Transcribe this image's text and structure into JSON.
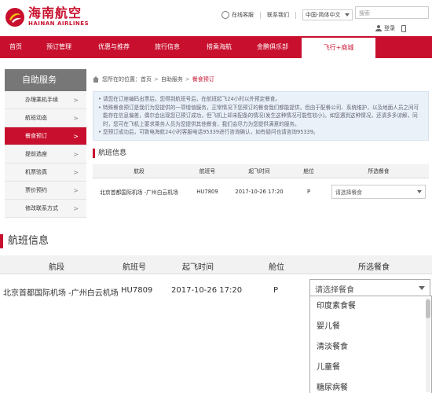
{
  "logo": {
    "cn": "海南航空",
    "en": "HAINAN AIRLINES"
  },
  "top_links": {
    "service": "在线客服",
    "contact": "联系我们",
    "language": "中国-简体中文",
    "search_placeholder": "搜索",
    "login": "登录",
    "phone_icon": "mobile-icon"
  },
  "nav": [
    "首页",
    "预订管理",
    "优惠与推荐",
    "旅行信息",
    "搭乘海航",
    "金鹏俱乐部",
    "飞行+商城"
  ],
  "sidebar": {
    "title": "自助服务",
    "items": [
      "办理乘机手续",
      "航班动态",
      "餐食预订",
      "提前选座",
      "机票验真",
      "票价预约",
      "修改联系方式"
    ],
    "active": "餐食预订"
  },
  "breadcrumb": {
    "prefix": "您所在的位置：",
    "home": "首页",
    "level2": "自助服务",
    "current": "餐食预订"
  },
  "notice": [
    "请您在订座编码出票后，您得到航班号后，在航班起飞24小时以外预定餐食。",
    "特殊餐食预订是我们为您提供的一项增值服务，正常情况下您预订的餐食我们都能提供，但由于配餐公司、系统维护，以及地面人员之间可能存在信息偏差，偶尔会出现您已预订成功，但飞机上却未配备的情况(发生这种情况可能性较小)。如您遇到这种情况，还请多多谅解，同时，您可在飞机上要求乘务人员为您提供其他餐食，我们会尽力为您提供满意的服务。",
    "您预订成功后，可致电海航24小时客服电话95339进行咨询确认，如有疑问也请咨询95339。"
  ],
  "flight_section": {
    "title": "航班信息",
    "headers": [
      "航段",
      "航班号",
      "起飞时间",
      "舱位",
      "所选餐食"
    ],
    "row": {
      "segment": "北京首都国际机场 -广州白云机场",
      "flight_no": "HU7809",
      "departure": "2017-10-26 17:20",
      "cabin": "P",
      "meal": "请选择餐食"
    }
  },
  "meal_options": [
    "印度素食餐",
    "婴儿餐",
    "清淡餐食",
    "儿童餐",
    "糖尿病餐"
  ],
  "colors": {
    "brand": "#c8102e",
    "sidebar_title": "#777777",
    "notice_bg": "#eaf1f8"
  }
}
